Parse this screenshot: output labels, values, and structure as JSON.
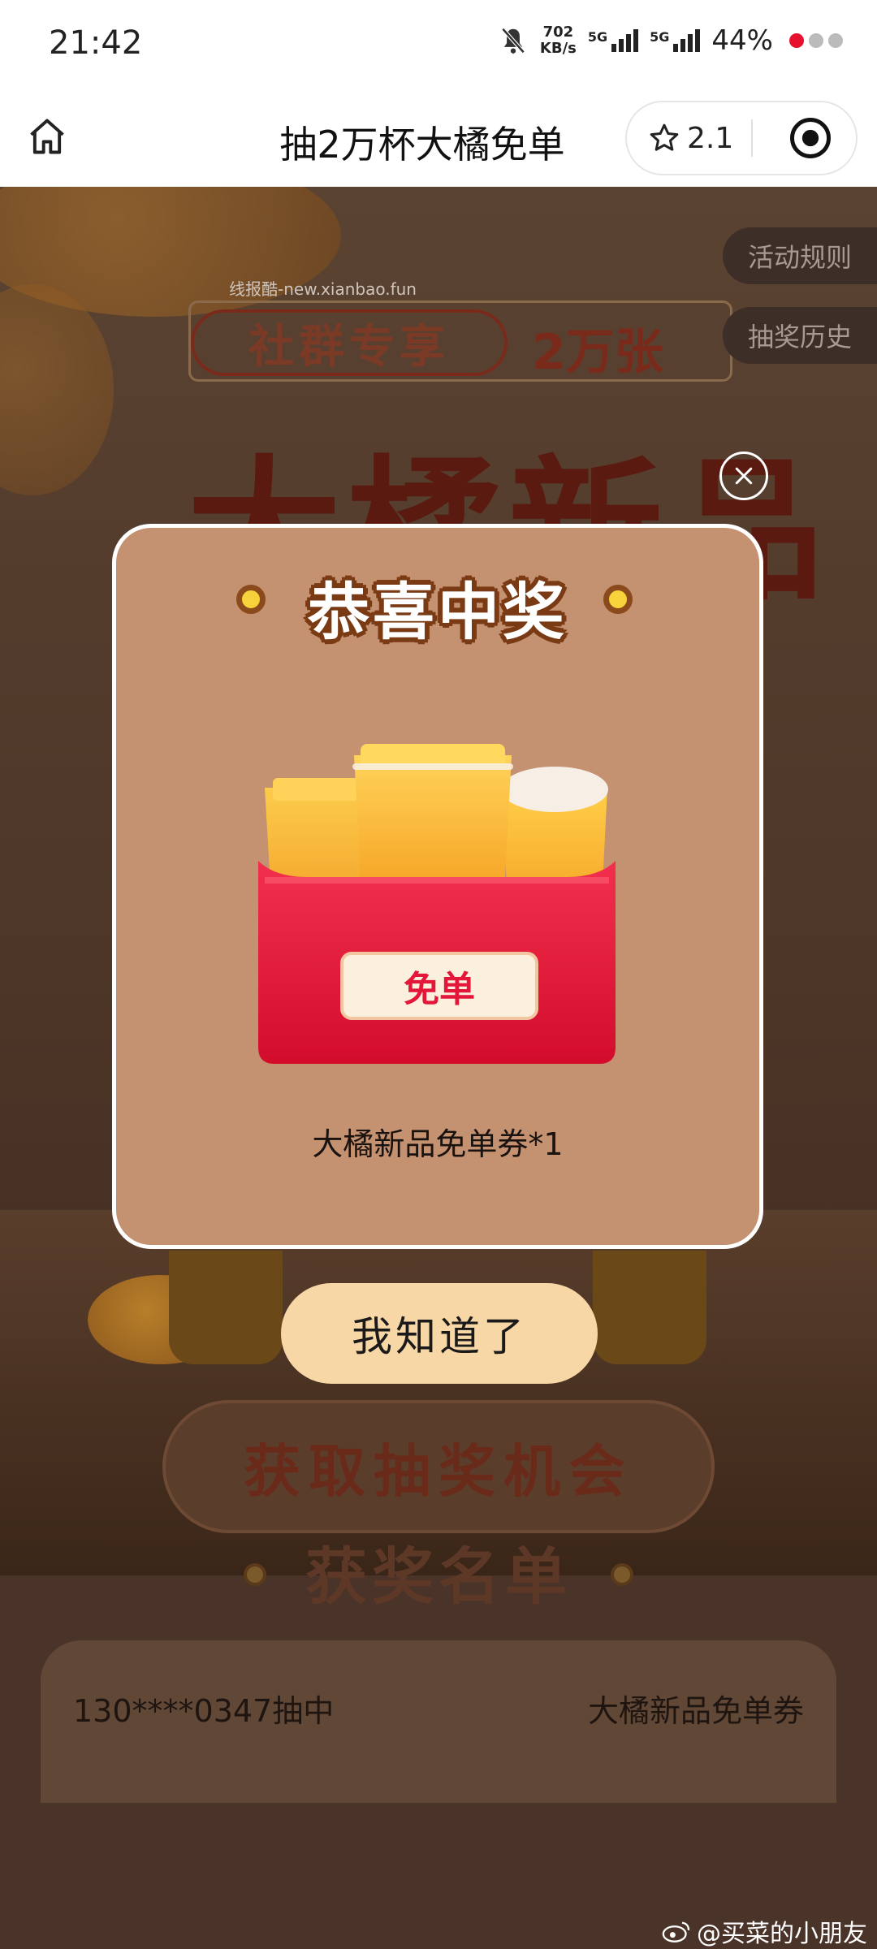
{
  "status_bar": {
    "time": "21:42",
    "net_speed_value": "702",
    "net_speed_unit": "KB/s",
    "signal1_label": "5G",
    "signal2_label": "5G",
    "battery": "44%"
  },
  "nav": {
    "title": "抽2万杯大橘免单",
    "star_count": "2.1"
  },
  "background": {
    "watermark": "线报酷-new.xianbao.fun",
    "banner_tag": "社群专享",
    "banner_count": "2万张",
    "big_title": "大橘新品",
    "side_buttons": [
      "活动规则",
      "抽奖历史"
    ],
    "get_chance_button": "获取抽奖机会",
    "winners_title": "获奖名单",
    "winners": [
      {
        "user": "130****0347抽中",
        "prize": "大橘新品免单券"
      }
    ]
  },
  "modal": {
    "title": "恭喜中奖",
    "badge_text": "免单",
    "prize_name": "大橘新品免单券*1",
    "confirm_button": "我知道了"
  },
  "footer_watermark": "@买菜的小朋友",
  "colors": {
    "modal_bg": "#c49171",
    "confirm_bg": "#f8d7a6",
    "badge_red": "#e3173a",
    "title_outline": "#7a3a14"
  }
}
